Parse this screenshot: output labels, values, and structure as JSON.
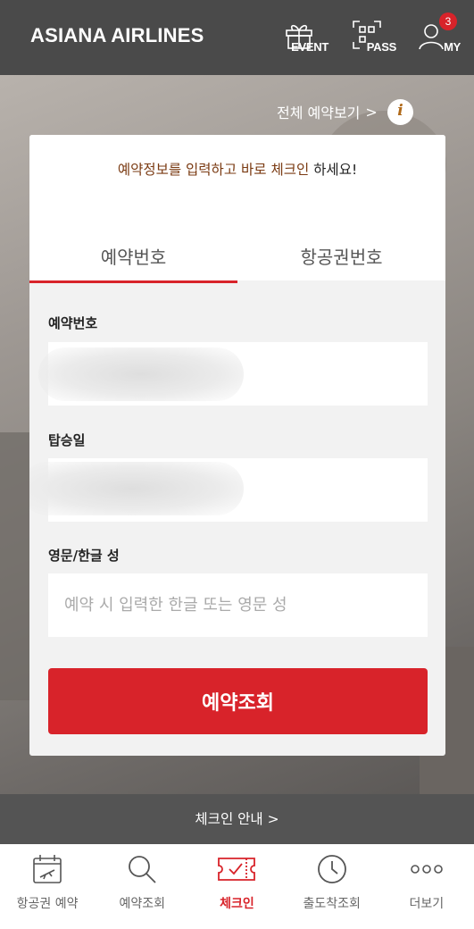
{
  "header": {
    "brand": "ASIANA AIRLINES",
    "event_label": "EVENT",
    "pass_label": "PASS",
    "my_label": "MY",
    "my_badge": "3"
  },
  "links": {
    "view_all": "전체 예약보기",
    "view_all_chevron": ">",
    "info": "i"
  },
  "card": {
    "prompt_highlight": "예약정보를 입력하고 바로 체크인",
    "prompt_rest": " 하세요!",
    "tabs": [
      "예약번호",
      "항공권번호"
    ],
    "active_tab": 0,
    "fields": {
      "booking_label": "예약번호",
      "date_label": "탑승일",
      "name_label": "영문/한글 성",
      "name_placeholder": "예약 시 입력한 한글 또는 영문 성"
    },
    "submit_label": "예약조회"
  },
  "guide": {
    "label": "체크인 안내 >"
  },
  "tabbar": {
    "items": [
      {
        "label": "항공권 예약",
        "icon": "calendar-plane-icon"
      },
      {
        "label": "예약조회",
        "icon": "search-icon"
      },
      {
        "label": "체크인",
        "icon": "ticket-check-icon"
      },
      {
        "label": "출도착조회",
        "icon": "clock-icon"
      },
      {
        "label": "더보기",
        "icon": "more-dots-icon"
      }
    ],
    "active_index": 2
  },
  "colors": {
    "accent": "#d8232a",
    "header_bg": "#4a4a4a",
    "guide_bg": "#545454"
  }
}
